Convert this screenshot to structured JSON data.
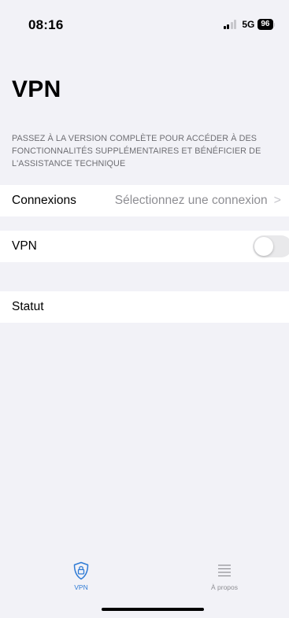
{
  "status_bar": {
    "time": "08:16",
    "network": "5G",
    "battery": "96"
  },
  "title": "VPN",
  "upsell_note": "PASSEZ À LA VERSION COMPLÈTE POUR ACCÉDER À DES FONCTIONNALITÉS SUPPLÉMENTAIRES ET BÉNÉFICIER DE L'ASSISTANCE TECHNIQUE",
  "rows": {
    "connections": {
      "label": "Connexions",
      "value": "Sélectionnez une connexion",
      "chevron": ">"
    },
    "vpn": {
      "label": "VPN",
      "toggle_on": false
    },
    "status": {
      "label": "Statut"
    }
  },
  "tab_bar": {
    "tabs": [
      {
        "label": "VPN",
        "icon": "lock-shield-icon",
        "active": true
      },
      {
        "label": "À propos",
        "icon": "list-icon",
        "active": false
      }
    ]
  },
  "colors": {
    "background": "#f2f2f7",
    "accent": "#2f7bd5",
    "secondary_text": "#8e8e93"
  }
}
